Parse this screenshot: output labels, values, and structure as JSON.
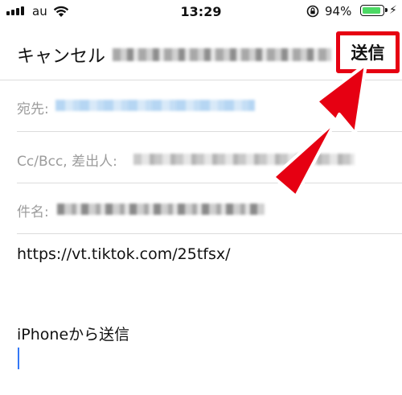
{
  "status_bar": {
    "carrier": "au",
    "time": "13:29",
    "battery_percent": "94%",
    "battery_level": 0.94,
    "signal_icon": "signal-bars-icon",
    "wifi_icon": "wifi-icon",
    "lock_icon": "rotation-lock-icon",
    "charging_icon": "charging-bolt-icon",
    "battery_color": "#4cd964"
  },
  "nav": {
    "cancel_label": "キャンセル",
    "send_label": "送信",
    "highlight_color": "#e60012"
  },
  "fields": {
    "to_label": "宛先:",
    "cc_label": "Cc/Bcc, 差出人:",
    "subject_label": "件名:"
  },
  "body": {
    "url": "https://vt.tiktok.com/25tfsx/",
    "signature": "iPhoneから送信"
  },
  "annotation": {
    "arrow_color": "#e60012"
  }
}
